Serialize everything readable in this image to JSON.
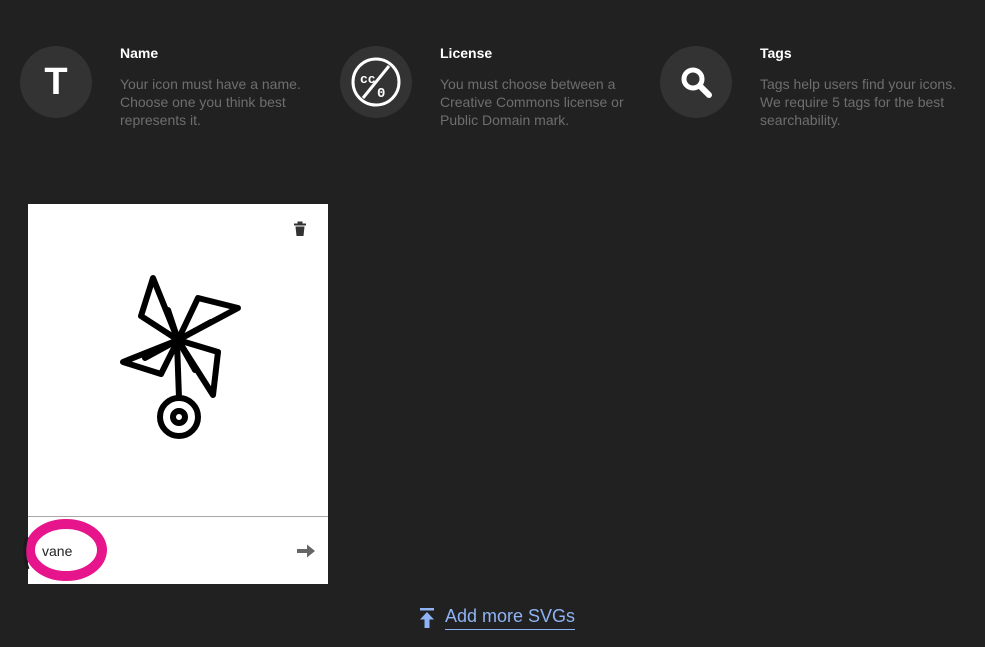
{
  "steps": [
    {
      "icon": "letter-t-icon",
      "glyph": "T",
      "title": "Name",
      "description": "Your icon must have a name. Choose one you think best represents it."
    },
    {
      "icon": "cc-zero-icon",
      "title": "License",
      "description": "You must choose between a Creative Commons license or Public Domain mark."
    },
    {
      "icon": "search-icon",
      "title": "Tags",
      "description": "Tags help users find your icons. We require 5 tags for the best searchability."
    }
  ],
  "card": {
    "icon_preview": "pinwheel-icon",
    "name_value": "vane",
    "delete_icon": "trash-icon",
    "next_icon": "arrow-right-icon",
    "marker_color": "#e6158c"
  },
  "add_more": {
    "icon": "upload-icon",
    "label": "Add more SVGs",
    "color": "#8fb3f4"
  }
}
